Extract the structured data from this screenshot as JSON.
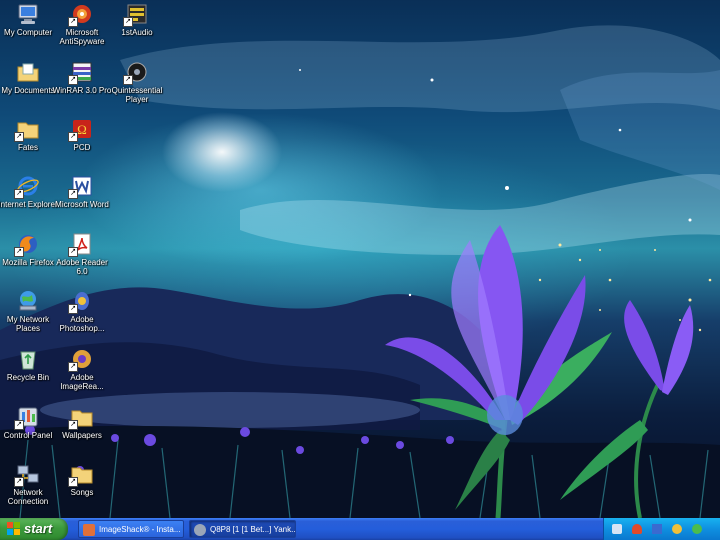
{
  "desktop": {
    "icons": [
      {
        "label": "My Computer",
        "icon": "computer-icon"
      },
      {
        "label": "Microsoft AntiSpyware",
        "icon": "antispyware-icon"
      },
      {
        "label": "1stAudio",
        "icon": "audio-icon"
      },
      {
        "label": "My Documents",
        "icon": "documents-folder-icon"
      },
      {
        "label": "WinRAR 3.0 Pro",
        "icon": "winrar-icon"
      },
      {
        "label": "Quintessential Player",
        "icon": "player-icon"
      },
      {
        "label": "Fates",
        "icon": "folder-icon"
      },
      {
        "label": "PCD",
        "icon": "pcd-icon"
      },
      {
        "label": "Internet Explorer",
        "icon": "internet-explorer-icon"
      },
      {
        "label": "Microsoft Word",
        "icon": "word-icon"
      },
      {
        "label": "Mozilla Firefox",
        "icon": "firefox-icon"
      },
      {
        "label": "Adobe Reader 6.0",
        "icon": "adobe-reader-icon"
      },
      {
        "label": "My Network Places",
        "icon": "network-places-icon"
      },
      {
        "label": "Adobe Photoshop...",
        "icon": "photoshop-icon"
      },
      {
        "label": "Recycle Bin",
        "icon": "recycle-bin-icon"
      },
      {
        "label": "Adobe ImageRea...",
        "icon": "imageready-icon"
      },
      {
        "label": "Control Panel",
        "icon": "control-panel-icon"
      },
      {
        "label": "Wallpapers",
        "icon": "folder-icon"
      },
      {
        "label": "Network Connection",
        "icon": "network-connection-icon"
      },
      {
        "label": "Songs",
        "icon": "folder-icon"
      }
    ]
  },
  "taskbar": {
    "start_label": "start",
    "tasks": [
      {
        "label": "ImageShack® - Insta...",
        "icon": "browser-icon",
        "active": false
      },
      {
        "label": "Q8P8 [1 [1 Bet...] Yank...",
        "icon": "app-icon",
        "active": true
      }
    ],
    "tray_icons": [
      "speaker-icon",
      "shield-icon",
      "network-icon",
      "antivirus-icon",
      "messenger-icon"
    ]
  },
  "colors": {
    "taskbar_blue": "#245edb",
    "start_green": "#3c9a3c",
    "tray_blue": "#0f8fe0"
  }
}
